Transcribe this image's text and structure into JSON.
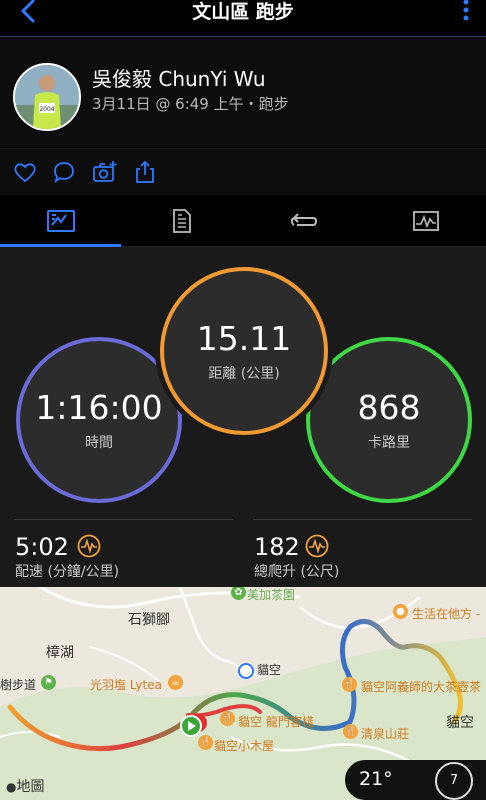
{
  "nav": {
    "title": "文山區 跑步",
    "back_icon": "chevron-left-icon",
    "more_icon": "kebab-menu-icon"
  },
  "profile": {
    "name": "吳俊毅 ChunYi Wu",
    "subtitle": "3月11日 @ 6:49 上午・跑步",
    "bib": "2004"
  },
  "social": {
    "icons": [
      "heart-icon",
      "comment-icon",
      "camera-add-icon",
      "share-icon"
    ]
  },
  "tabs": [
    {
      "name": "stats-icon",
      "active": true
    },
    {
      "name": "details-icon",
      "active": false
    },
    {
      "name": "laps-icon",
      "active": false
    },
    {
      "name": "chart-icon",
      "active": false
    }
  ],
  "stats": {
    "time": {
      "value": "1:16:00",
      "label": "時間",
      "color": "#6a6bd8"
    },
    "distance": {
      "value": "15.11",
      "label": "距離 (公里)",
      "color": "#f19a32"
    },
    "calories": {
      "value": "868",
      "label": "卡路里",
      "color": "#3ed844"
    },
    "pace": {
      "value": "5:02",
      "label": "配速 (分鐘/公里)"
    },
    "ascent": {
      "value": "182",
      "label": "總爬升 (公尺)"
    },
    "accent": "#f4a23a"
  },
  "map": {
    "labels": {
      "shishijiao": "石獅腳",
      "zhanghu": "樟湖",
      "trail": "樹步道",
      "maokong": "貓空",
      "maokong_east": "貓空",
      "maps_logo": "地圖"
    },
    "pois": {
      "meijia": "美加茶園",
      "lytea": "光羽塩 Lytea",
      "longmen": "貓空 龍門客棧",
      "cabin": "貓空小木屋",
      "qingquan": "清泉山莊",
      "shenghuo": "生活在他方 -",
      "ayi": "貓空阿義師的大茶壺茶"
    },
    "weather": {
      "temp": "21°",
      "gauge": "7"
    }
  }
}
